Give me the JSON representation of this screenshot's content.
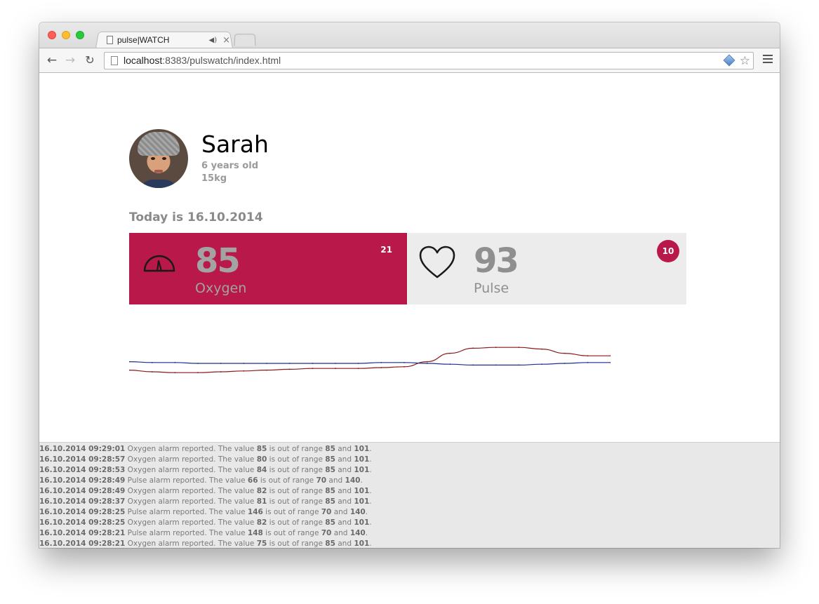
{
  "browser": {
    "tab_title": "pulse|WATCH",
    "tab_audio_icon": "speaker-icon",
    "tab_close": "×",
    "url_host": "localhost",
    "url_rest": ":8383/pulswatch/index.html"
  },
  "patient": {
    "name": "Sarah",
    "age": "6 years old",
    "weight": "15kg"
  },
  "today_label": "Today is 16.10.2014",
  "cards": {
    "oxygen": {
      "value": "85",
      "label": "Oxygen",
      "alarm_count": "21",
      "icon": "gauge-icon",
      "bg_color": "#b8184a"
    },
    "pulse": {
      "value": "93",
      "label": "Pulse",
      "alarm_count": "10",
      "icon": "heart-icon",
      "bg_color": "#ececec"
    }
  },
  "chart_data": {
    "type": "line",
    "series": [
      {
        "color": "#8b1a1a",
        "values": [
          28,
          30,
          31,
          31,
          30,
          29,
          28,
          27,
          26,
          26,
          26,
          25,
          24,
          18,
          8,
          2,
          1,
          1,
          3,
          8,
          11,
          11
        ]
      },
      {
        "color": "#1c2f8f",
        "values": [
          18,
          19,
          19,
          20,
          20,
          20,
          20,
          20,
          20,
          20,
          20,
          19,
          19,
          20,
          21,
          22,
          22,
          22,
          21,
          20,
          19,
          19
        ]
      }
    ],
    "grid": false
  },
  "alarm_log": [
    {
      "ts": "16.10.2014 09:29:01",
      "kind": "Oxygen",
      "value": "85",
      "low": "85",
      "high": "101"
    },
    {
      "ts": "16.10.2014 09:28:57",
      "kind": "Oxygen",
      "value": "80",
      "low": "85",
      "high": "101"
    },
    {
      "ts": "16.10.2014 09:28:53",
      "kind": "Oxygen",
      "value": "84",
      "low": "85",
      "high": "101"
    },
    {
      "ts": "16.10.2014 09:28:49",
      "kind": "Pulse",
      "value": "66",
      "low": "70",
      "high": "140"
    },
    {
      "ts": "16.10.2014 09:28:49",
      "kind": "Oxygen",
      "value": "82",
      "low": "85",
      "high": "101"
    },
    {
      "ts": "16.10.2014 09:28:37",
      "kind": "Oxygen",
      "value": "81",
      "low": "85",
      "high": "101"
    },
    {
      "ts": "16.10.2014 09:28:25",
      "kind": "Pulse",
      "value": "146",
      "low": "70",
      "high": "140"
    },
    {
      "ts": "16.10.2014 09:28:25",
      "kind": "Oxygen",
      "value": "82",
      "low": "85",
      "high": "101"
    },
    {
      "ts": "16.10.2014 09:28:21",
      "kind": "Pulse",
      "value": "148",
      "low": "70",
      "high": "140"
    },
    {
      "ts": "16.10.2014 09:28:21",
      "kind": "Oxygen",
      "value": "75",
      "low": "85",
      "high": "101"
    }
  ]
}
